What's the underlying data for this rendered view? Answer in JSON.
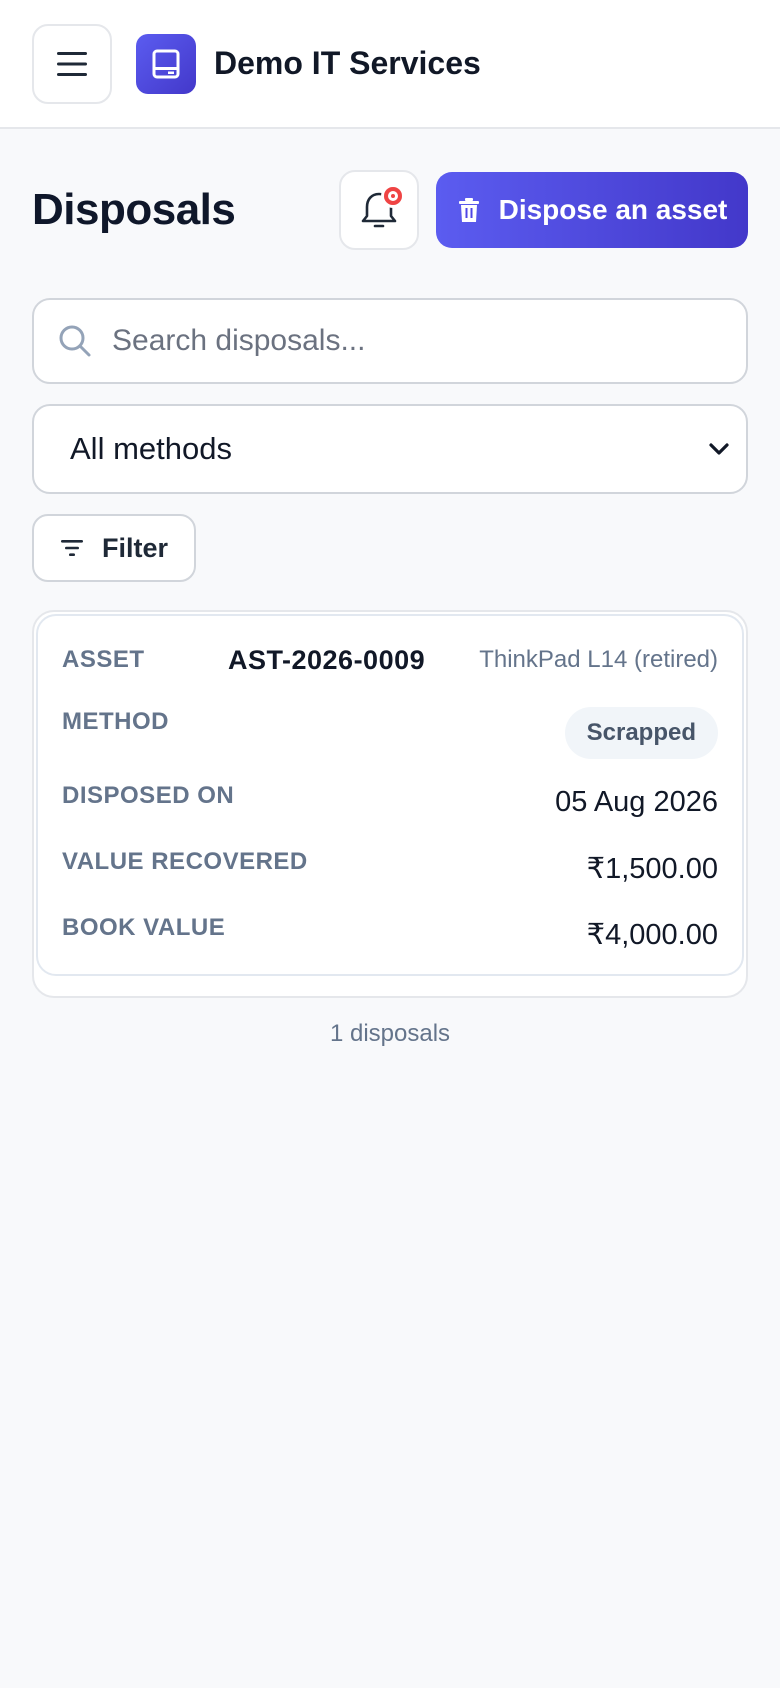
{
  "header": {
    "app_title": "Demo IT Services"
  },
  "page": {
    "title": "Disposals",
    "dispose_button_label": "Dispose an asset"
  },
  "search": {
    "placeholder": "Search disposals...",
    "value": ""
  },
  "method_filter": {
    "selected": "All methods"
  },
  "filter_button_label": "Filter",
  "card": {
    "asset_label": "ASSET",
    "asset_id": "AST-2026-0009",
    "asset_name": "ThinkPad L14 (retired)",
    "method_label": "METHOD",
    "method_value": "Scrapped",
    "disposed_on_label": "DISPOSED ON",
    "disposed_on_value": "05 Aug 2026",
    "value_recovered_label": "VALUE RECOVERED",
    "value_recovered_value": "₹1,500.00",
    "book_value_label": "BOOK VALUE",
    "book_value_value": "₹4,000.00"
  },
  "footer": {
    "count_text": "1 disposals"
  },
  "colors": {
    "accent": "#5b5cf0",
    "accent_dark": "#4338ca",
    "notification_dot": "#ef4444"
  },
  "icons": [
    "menu-icon",
    "logo-icon",
    "bell-icon",
    "trash-icon",
    "search-icon",
    "chevron-down-icon",
    "filter-icon"
  ]
}
